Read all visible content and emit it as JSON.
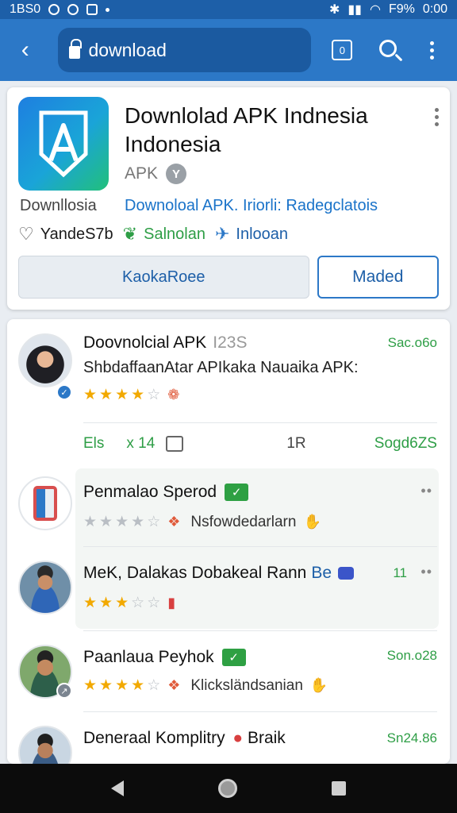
{
  "status_bar": {
    "left_text": "1BS0",
    "right_text": "F9%",
    "time": "0:00"
  },
  "browser": {
    "url_text": "download",
    "tab_count": "0"
  },
  "app": {
    "title": "Downlolad APK Indnesia Indonesia",
    "type_label": "APK",
    "badge": "Y",
    "developer": "Downllosia",
    "link_text": "Downoloal APK. Iriorli: Radegclatois",
    "meta1": "YandeS7b",
    "meta2": "Salnolan",
    "meta3": "Inlooan",
    "secondary_button": "KaokaRoee",
    "primary_button": "Maded"
  },
  "reviews": [
    {
      "title": "Doovnolcial APK",
      "count": "I23S",
      "date": "Sac.o6o",
      "subtitle": "ShbdaffaanAtar APIkaka Nauaika APK:",
      "stars": 4
    },
    {
      "title": "Penmalao Sperod",
      "date": "",
      "stars_text": "Nsfowdedarlarn",
      "stars": 0
    },
    {
      "title": "MeK, Dalakas Dobakeal Rann",
      "title_blue": "Be",
      "date": "11",
      "stars": 3
    },
    {
      "title": "Paanlaua Peyhok",
      "date": "Son.o28",
      "stars_text": "Klicksländsanian",
      "stars": 3.5
    },
    {
      "title": "Deneraal Komplitry",
      "title_tail": "Braik",
      "date": "Sn24.86"
    }
  ],
  "stats": {
    "a": "Els",
    "b": "x 14",
    "c": "1R",
    "d": "Sogd6ZS"
  },
  "colors": {
    "accent": "#2c78c7",
    "status": "#1d5fa8",
    "green": "#2e9e46",
    "star": "#f2a900"
  }
}
